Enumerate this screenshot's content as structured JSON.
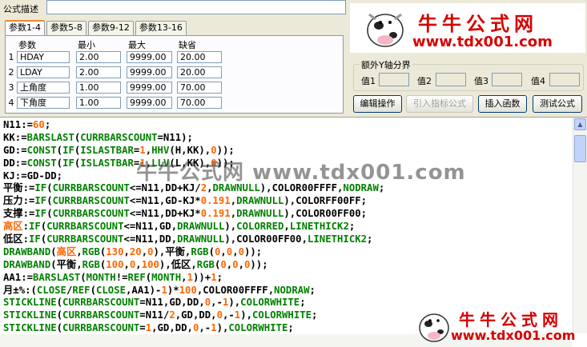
{
  "form": {
    "desc_label": "公式描述",
    "desc_value": ""
  },
  "tabs": [
    "参数1-4",
    "参数5-8",
    "参数9-12",
    "参数13-16"
  ],
  "params": {
    "headers": [
      "参数",
      "最小",
      "最大",
      "缺省"
    ],
    "rows": [
      {
        "num": "1",
        "name": "HDAY",
        "min": "2.00",
        "max": "9999.00",
        "default": "20.00"
      },
      {
        "num": "2",
        "name": "LDAY",
        "min": "2.00",
        "max": "9999.00",
        "default": "20.00"
      },
      {
        "num": "3",
        "name": "上角度",
        "min": "1.00",
        "max": "9999.00",
        "default": "70.00"
      },
      {
        "num": "4",
        "name": "下角度",
        "min": "1.00",
        "max": "9999.00",
        "default": "70.00"
      }
    ]
  },
  "logo": {
    "title": "牛牛公式网",
    "url": "www.tdx001.com"
  },
  "yaxis": {
    "title": "额外Y轴分界",
    "labels": [
      "值1",
      "值2",
      "值3",
      "值4"
    ],
    "values": [
      "",
      "",
      "",
      ""
    ]
  },
  "buttons": {
    "edit": "编辑操作",
    "import_indicator": "引入指标公式",
    "insert_function": "插入函数",
    "test_formula": "测试公式"
  },
  "watermark": "牛牛公式网 www.tdx001.com",
  "code_lines": [
    [
      [
        "N11:=",
        "k"
      ],
      [
        "60",
        "n"
      ],
      [
        ";",
        "k"
      ]
    ],
    [
      [
        "KK:=",
        "k"
      ],
      [
        "BARSLAST",
        "f"
      ],
      [
        "(",
        "k"
      ],
      [
        "CURRBARSCOUNT",
        "f"
      ],
      [
        "=N11);",
        "k"
      ]
    ],
    [
      [
        "GD:=",
        "k"
      ],
      [
        "CONST",
        "f"
      ],
      [
        "(",
        "k"
      ],
      [
        "IF",
        "f"
      ],
      [
        "(",
        "k"
      ],
      [
        "ISLASTBAR",
        "f"
      ],
      [
        "=",
        "k"
      ],
      [
        "1",
        "n"
      ],
      [
        ",",
        "k"
      ],
      [
        "HHV",
        "f"
      ],
      [
        "(H,KK),",
        "k"
      ],
      [
        "0",
        "n"
      ],
      [
        "));",
        "k"
      ]
    ],
    [
      [
        "DD:=",
        "k"
      ],
      [
        "CONST",
        "f"
      ],
      [
        "(",
        "k"
      ],
      [
        "IF",
        "f"
      ],
      [
        "(",
        "k"
      ],
      [
        "ISLASTBAR",
        "f"
      ],
      [
        "=",
        "k"
      ],
      [
        "1",
        "n"
      ],
      [
        ",",
        "k"
      ],
      [
        "LLV",
        "f"
      ],
      [
        "(L,KK),",
        "k"
      ],
      [
        "0",
        "n"
      ],
      [
        "));",
        "k"
      ]
    ],
    [
      [
        "KJ:=GD-DD;",
        "k"
      ]
    ],
    [
      [
        "平衡:=",
        "k"
      ],
      [
        "IF",
        "f"
      ],
      [
        "(",
        "k"
      ],
      [
        "CURRBARSCOUNT",
        "f"
      ],
      [
        "<=N11,DD+KJ/",
        "k"
      ],
      [
        "2",
        "n"
      ],
      [
        ",",
        "k"
      ],
      [
        "DRAWNULL",
        "f"
      ],
      [
        "),COLOR00FFFF,",
        "k"
      ],
      [
        "NODRAW",
        "f"
      ],
      [
        ";",
        "k"
      ]
    ],
    [
      [
        "压力:=",
        "k"
      ],
      [
        "IF",
        "f"
      ],
      [
        "(",
        "k"
      ],
      [
        "CURRBARSCOUNT",
        "f"
      ],
      [
        "<=N11,GD-KJ*",
        "k"
      ],
      [
        "0.191",
        "n"
      ],
      [
        ",",
        "k"
      ],
      [
        "DRAWNULL",
        "f"
      ],
      [
        "),COLORFF00FF;",
        "k"
      ]
    ],
    [
      [
        "支撑:=",
        "k"
      ],
      [
        "IF",
        "f"
      ],
      [
        "(",
        "k"
      ],
      [
        "CURRBARSCOUNT",
        "f"
      ],
      [
        "<=N11,DD+KJ*",
        "k"
      ],
      [
        "0.191",
        "n"
      ],
      [
        ",",
        "k"
      ],
      [
        "DRAWNULL",
        "f"
      ],
      [
        "),COLOR00FF00;",
        "k"
      ]
    ],
    [
      [
        "高区",
        "n"
      ],
      [
        ":",
        "k"
      ],
      [
        "IF",
        "f"
      ],
      [
        "(",
        "k"
      ],
      [
        "CURRBARSCOUNT",
        "f"
      ],
      [
        "<=N11,GD,",
        "k"
      ],
      [
        "DRAWNULL",
        "f"
      ],
      [
        "),",
        "k"
      ],
      [
        "COLORRED",
        "f"
      ],
      [
        ",",
        "k"
      ],
      [
        "LINETHICK2",
        "f"
      ],
      [
        ";",
        "k"
      ]
    ],
    [
      [
        "低区:",
        "k"
      ],
      [
        "IF",
        "f"
      ],
      [
        "(",
        "k"
      ],
      [
        "CURRBARSCOUNT",
        "f"
      ],
      [
        "<=N11,DD,",
        "k"
      ],
      [
        "DRAWNULL",
        "f"
      ],
      [
        "),COLOR00FF00,",
        "k"
      ],
      [
        "LINETHICK2",
        "f"
      ],
      [
        ";",
        "k"
      ]
    ],
    [
      [
        "DRAWBAND",
        "f"
      ],
      [
        "(",
        "k"
      ],
      [
        "高区",
        "n"
      ],
      [
        ",",
        "k"
      ],
      [
        "RGB",
        "f"
      ],
      [
        "(",
        "k"
      ],
      [
        "130",
        "n"
      ],
      [
        ",",
        "k"
      ],
      [
        "20",
        "n"
      ],
      [
        ",",
        "k"
      ],
      [
        "0",
        "n"
      ],
      [
        "),平衡,",
        "k"
      ],
      [
        "RGB",
        "f"
      ],
      [
        "(",
        "k"
      ],
      [
        "0",
        "n"
      ],
      [
        ",",
        "k"
      ],
      [
        "0",
        "n"
      ],
      [
        ",",
        "k"
      ],
      [
        "0",
        "n"
      ],
      [
        "));",
        "k"
      ]
    ],
    [
      [
        "DRAWBAND",
        "f"
      ],
      [
        "(平衡,",
        "k"
      ],
      [
        "RGB",
        "f"
      ],
      [
        "(",
        "k"
      ],
      [
        "100",
        "n"
      ],
      [
        ",",
        "k"
      ],
      [
        "0",
        "n"
      ],
      [
        ",",
        "k"
      ],
      [
        "100",
        "n"
      ],
      [
        "),低区,",
        "k"
      ],
      [
        "RGB",
        "f"
      ],
      [
        "(",
        "k"
      ],
      [
        "0",
        "n"
      ],
      [
        ",",
        "k"
      ],
      [
        "0",
        "n"
      ],
      [
        ",",
        "k"
      ],
      [
        "0",
        "n"
      ],
      [
        "));",
        "k"
      ]
    ],
    [
      [
        "AA1:=",
        "k"
      ],
      [
        "BARSLAST",
        "f"
      ],
      [
        "(",
        "k"
      ],
      [
        "MONTH",
        "f"
      ],
      [
        "!=",
        "k"
      ],
      [
        "REF",
        "f"
      ],
      [
        "(",
        "k"
      ],
      [
        "MONTH",
        "f"
      ],
      [
        ",",
        "k"
      ],
      [
        "1",
        "n"
      ],
      [
        "))+",
        "k"
      ],
      [
        "1",
        "n"
      ],
      [
        ";",
        "k"
      ]
    ],
    [
      [
        "月±%:(",
        "k"
      ],
      [
        "CLOSE",
        "f"
      ],
      [
        "/",
        "k"
      ],
      [
        "REF",
        "f"
      ],
      [
        "(",
        "k"
      ],
      [
        "CLOSE",
        "f"
      ],
      [
        ",AA1)-",
        "k"
      ],
      [
        "1",
        "n"
      ],
      [
        ")*",
        "k"
      ],
      [
        "100",
        "n"
      ],
      [
        ",COLOR00FFFF,",
        "k"
      ],
      [
        "NODRAW",
        "f"
      ],
      [
        ";",
        "k"
      ]
    ],
    [
      [
        "STICKLINE",
        "f"
      ],
      [
        "(",
        "k"
      ],
      [
        "CURRBARSCOUNT",
        "f"
      ],
      [
        "=N11,GD,DD,",
        "k"
      ],
      [
        "0",
        "n"
      ],
      [
        ",-",
        "k"
      ],
      [
        "1",
        "n"
      ],
      [
        "),",
        "k"
      ],
      [
        "COLORWHITE",
        "f"
      ],
      [
        ";",
        "k"
      ]
    ],
    [
      [
        "STICKLINE",
        "f"
      ],
      [
        "(",
        "k"
      ],
      [
        "CURRBARSCOUNT",
        "f"
      ],
      [
        "=N11/",
        "k"
      ],
      [
        "2",
        "n"
      ],
      [
        ",GD,DD,",
        "k"
      ],
      [
        "0",
        "n"
      ],
      [
        ",-",
        "k"
      ],
      [
        "1",
        "n"
      ],
      [
        "),",
        "k"
      ],
      [
        "COLORWHITE",
        "f"
      ],
      [
        ";",
        "k"
      ]
    ],
    [
      [
        "STICKLINE",
        "f"
      ],
      [
        "(",
        "k"
      ],
      [
        "CURRBARSCOUNT",
        "f"
      ],
      [
        "=",
        "k"
      ],
      [
        "1",
        "n"
      ],
      [
        ",GD,DD,",
        "k"
      ],
      [
        "0",
        "n"
      ],
      [
        ",-",
        "k"
      ],
      [
        "1",
        "n"
      ],
      [
        "),",
        "k"
      ],
      [
        "COLORWHITE",
        "f"
      ],
      [
        ";",
        "k"
      ]
    ]
  ],
  "colors": {
    "keyword": "#008000",
    "number": "#ff6600",
    "plain": "#000000",
    "brand_red": "#d60000"
  }
}
